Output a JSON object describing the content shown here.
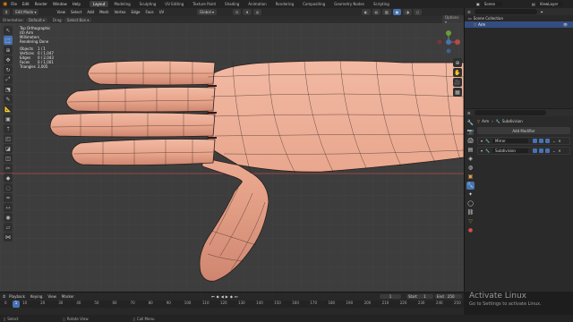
{
  "topbar": {
    "menu": [
      "File",
      "Edit",
      "Render",
      "Window",
      "Help"
    ],
    "workspaces": [
      "Layout",
      "Modeling",
      "Sculpting",
      "UV Editing",
      "Texture Paint",
      "Shading",
      "Animation",
      "Rendering",
      "Compositing",
      "Geometry Nodes",
      "Scripting"
    ],
    "active_workspace": "Layout",
    "scene_label": "Scene",
    "view_layer_label": "ViewLayer"
  },
  "viewport_header": {
    "mode": "Edit Mode",
    "menus": [
      "View",
      "Select",
      "Add",
      "Mesh",
      "Vertex",
      "Edge",
      "Face",
      "UV"
    ],
    "transform": "Global",
    "orientation_label": "Orientation:",
    "orientation_value": "Default",
    "drag_label": "Drag:",
    "drag_value": "Select Box",
    "options_label": "Options"
  },
  "overlay_info": {
    "lines": [
      "Top Orthographic",
      "(0) Arm",
      "Millimeters",
      "Rendering Done"
    ],
    "stats": [
      {
        "label": "Objects",
        "value": "1 / 1"
      },
      {
        "label": "Vertices",
        "value": "0 / 1,047"
      },
      {
        "label": "Edges",
        "value": "0 / 2,043"
      },
      {
        "label": "Faces",
        "value": "0 / 1,001"
      },
      {
        "label": "Triangles",
        "value": "2,005"
      }
    ]
  },
  "outliner": {
    "root": "Scene Collection",
    "items": [
      {
        "label": "Arm",
        "selected": true
      }
    ]
  },
  "properties": {
    "breadcrumb_object": "Arm",
    "breadcrumb_modifier": "Subdivision",
    "add_modifier_label": "Add Modifier",
    "modifiers": [
      "Mirror",
      "Subdivision"
    ]
  },
  "timeline": {
    "menus": [
      "Playback",
      "Keying",
      "View",
      "Marker"
    ],
    "current_frame": "1",
    "start_label": "Start",
    "start_value": "1",
    "end_label": "End",
    "end_value": "250",
    "ticks": [
      "0",
      "10",
      "20",
      "30",
      "40",
      "50",
      "60",
      "70",
      "80",
      "90",
      "100",
      "110",
      "120",
      "130",
      "140",
      "150",
      "160",
      "170",
      "180",
      "190",
      "200",
      "210",
      "220",
      "230",
      "240",
      "250"
    ]
  },
  "statusbar": {
    "items": [
      "Select",
      "Rotate View",
      "Call Menu"
    ]
  },
  "watermark": {
    "title": "Activate Linux",
    "subtitle": "Go to Settings to activate Linux."
  },
  "colors": {
    "accent": "#4772b3",
    "skin": "#e8a58c",
    "viewport_bg": "#3d3d3d",
    "x_axis": "#b44a4a",
    "y_axis": "#6a9c3a"
  }
}
